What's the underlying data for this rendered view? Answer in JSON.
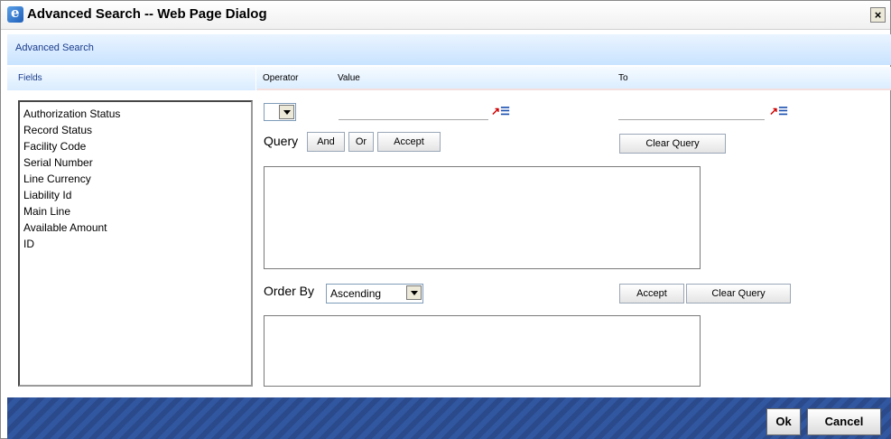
{
  "window": {
    "title": "Advanced Search -- Web Page Dialog",
    "close_label": "×"
  },
  "subheader": {
    "title": "Advanced Search"
  },
  "columns": {
    "fields": "Fields",
    "operator": "Operator",
    "value": "Value",
    "to": "To"
  },
  "fields_list": [
    "Authorization Status",
    "Record Status",
    "Facility Code",
    "Serial Number",
    "Line Currency",
    "Liability Id",
    "Main Line",
    "Available Amount",
    "ID"
  ],
  "query": {
    "label": "Query",
    "and": "And",
    "or": "Or",
    "accept": "Accept",
    "clear": "Clear Query",
    "value_input": "",
    "to_input": "",
    "lov_icon_glyph": "↗",
    "lov_icon_bars": "☰"
  },
  "order": {
    "label": "Order By",
    "selected": "Ascending",
    "accept": "Accept",
    "clear": "Clear Query"
  },
  "footer": {
    "ok": "Ok",
    "cancel": "Cancel"
  }
}
